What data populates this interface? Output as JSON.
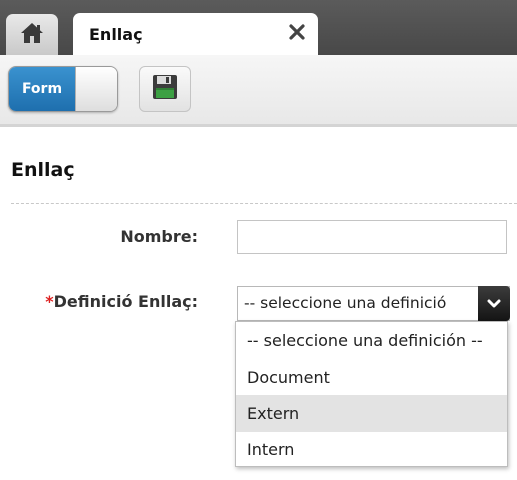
{
  "tabs": {
    "home_icon": "home-icon",
    "active_tab_label": "Enllaç",
    "close_icon": "close-icon"
  },
  "toolbar": {
    "form_toggle_label": "Form",
    "form_toggle_on": true,
    "save_icon": "floppy-disk-icon"
  },
  "section": {
    "title": "Enllaç"
  },
  "fields": {
    "nombre": {
      "label": "Nombre:",
      "value": ""
    },
    "definicio": {
      "required_marker": "*",
      "label": "Definició Enllaç:",
      "selected_value": "-- seleccione una definició",
      "options": [
        "-- seleccione una definición --",
        "Document",
        "Extern",
        "Intern"
      ],
      "hovered_option": "Extern"
    }
  },
  "colors": {
    "tabbar_bg": "#4e4e4e",
    "toggle_accent": "#2a80c0",
    "required_marker": "#dd2222",
    "hover_option_bg": "#e3e3e3"
  }
}
